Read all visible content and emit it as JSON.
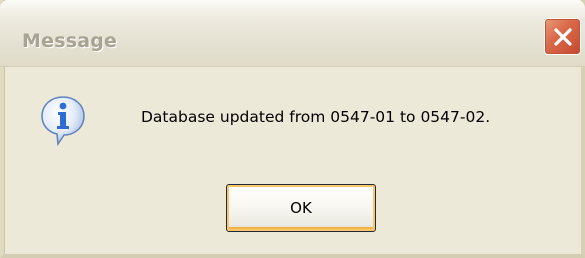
{
  "dialog": {
    "title": "Message",
    "message": "Database updated from 0547-01 to 0547-02.",
    "ok_label": "OK",
    "icon": "info-icon",
    "close_icon": "close-icon"
  },
  "colors": {
    "window_bg": "#ece9d8",
    "close_button": "#da6b4a",
    "title_text": "#a8a392",
    "icon_blue": "#2f6bd1"
  }
}
